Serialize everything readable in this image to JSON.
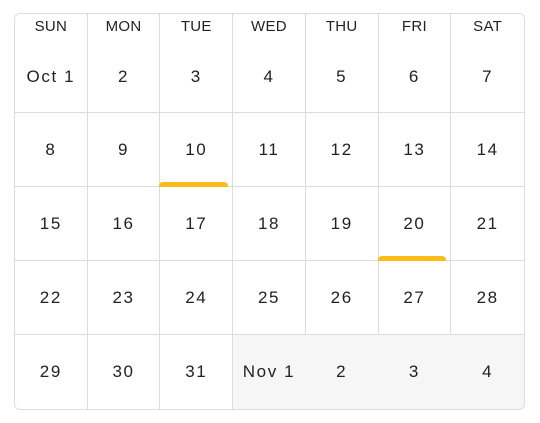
{
  "calendar": {
    "weekdays": [
      "SUN",
      "MON",
      "TUE",
      "WED",
      "THU",
      "FRI",
      "SAT"
    ],
    "weeks": [
      [
        "Oct 1",
        "2",
        "3",
        "4",
        "5",
        "6",
        "7"
      ],
      [
        "8",
        "9",
        "10",
        "11",
        "12",
        "13",
        "14"
      ],
      [
        "15",
        "16",
        "17",
        "18",
        "19",
        "20",
        "21"
      ],
      [
        "22",
        "23",
        "24",
        "25",
        "26",
        "27",
        "28"
      ],
      [
        "29",
        "30",
        "31",
        "Nov 1",
        "2",
        "3",
        "4"
      ]
    ],
    "events": [
      {
        "date": "10",
        "color": "#fbbc1b"
      },
      {
        "date": "20",
        "color": "#fbbc1b"
      }
    ],
    "colors": {
      "event": "#fbbc1b",
      "other_month_bg": "#f6f6f6",
      "grid_line": "#dadce0"
    }
  }
}
